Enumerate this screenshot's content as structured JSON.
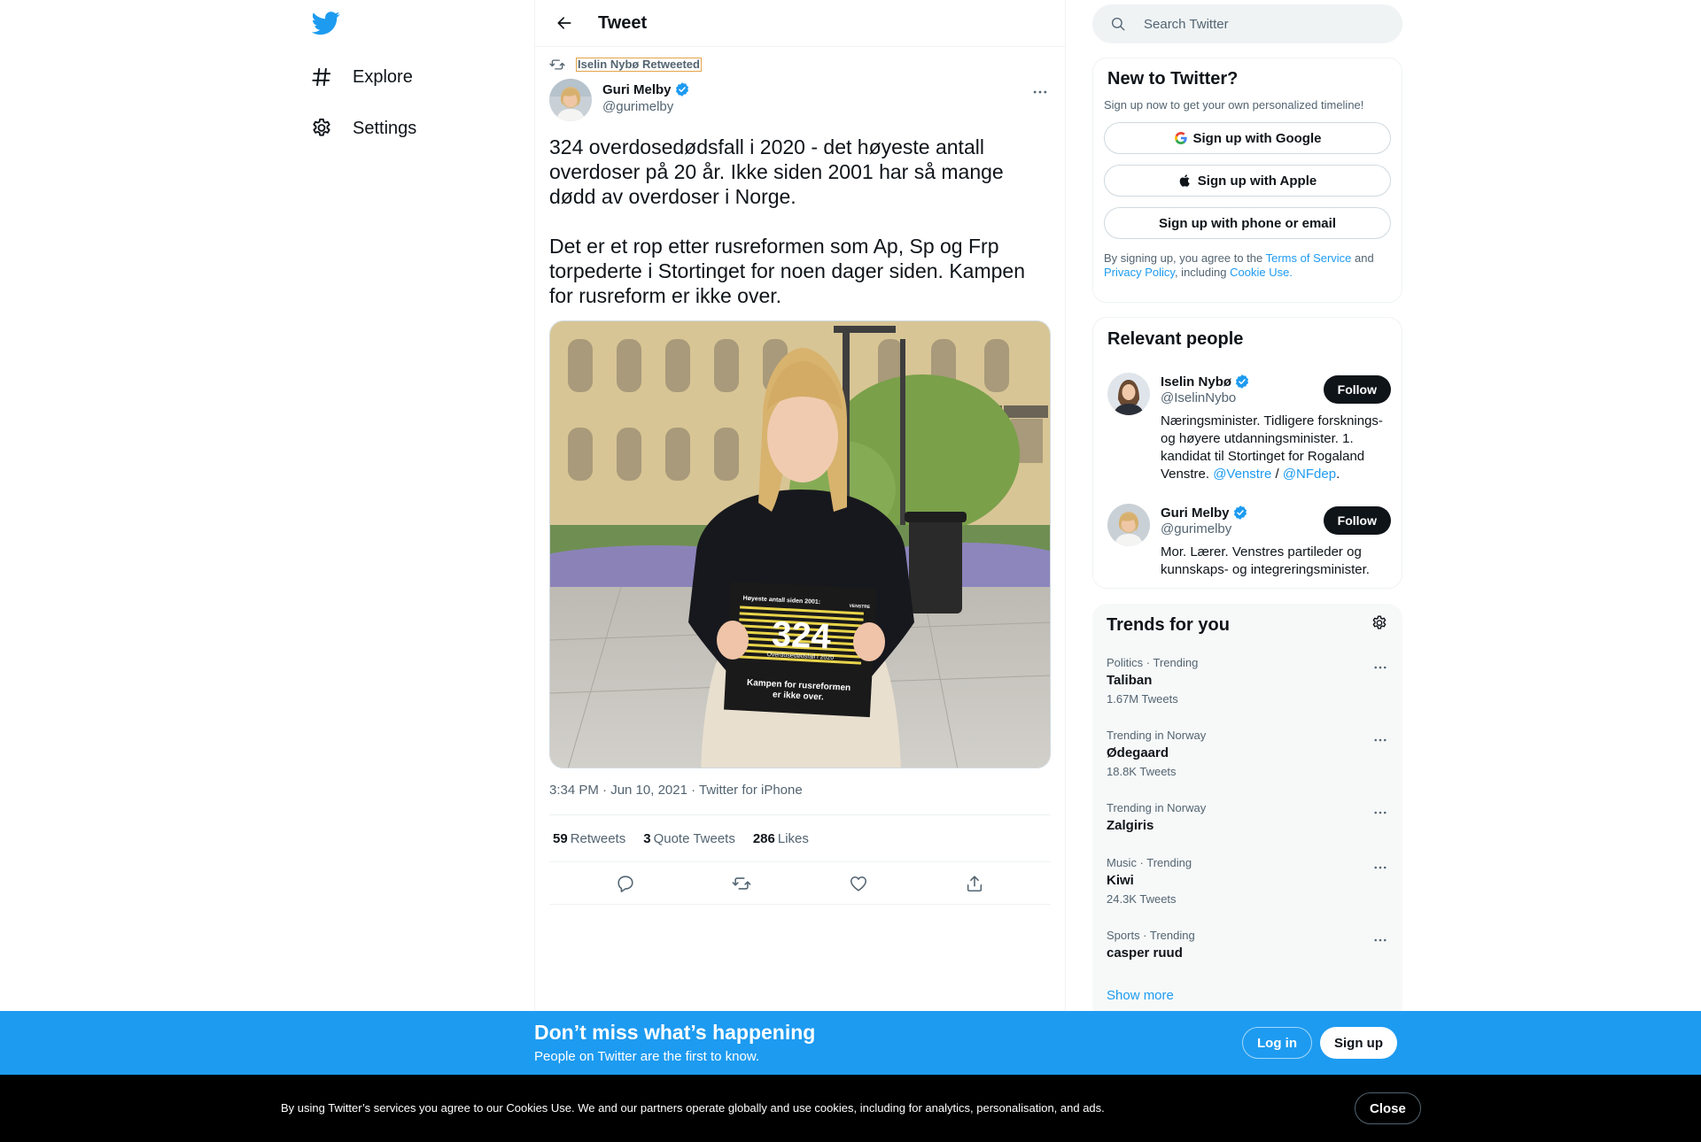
{
  "nav": {
    "explore": "Explore",
    "settings": "Settings"
  },
  "main": {
    "title": "Tweet",
    "retweeted_by": "Iselin Nybø Retweeted",
    "author_name": "Guri Melby",
    "author_handle": "@gurimelby",
    "text": "324 overdosedødsfall i 2020 - det høyeste antall overdoser på 20 år. Ikke siden 2001 har så mange dødd av overdoser i Norge.\n\nDet er et rop etter rusreformen som Ap, Sp og Frp torpederte i Stortinget for noen dager siden. Kampen for rusreform er ikke over.",
    "sign": {
      "header": "Høyeste antall siden 2001:",
      "number": "324",
      "caption": "Overdosedødsfall i 2020",
      "slogan_1": "Kampen for rusreformen",
      "slogan_2": "er ikke over.",
      "party": "VENSTRE"
    },
    "timestamp": "3:34 PM · Jun 10, 2021 · Twitter for iPhone",
    "retweets_count": "59",
    "retweets_label": "Retweets",
    "quotes_count": "3",
    "quotes_label": "Quote Tweets",
    "likes_count": "286",
    "likes_label": "Likes"
  },
  "search": {
    "placeholder": "Search Twitter"
  },
  "new_to_twitter": {
    "title": "New to Twitter?",
    "subtitle": "Sign up now to get your own personalized timeline!",
    "google": "Sign up with Google",
    "apple": "Sign up with Apple",
    "phone": "Sign up with phone or email",
    "legal_1": "By signing up, you agree to the ",
    "terms": "Terms of Service",
    "legal_2": " and ",
    "privacy": "Privacy Policy",
    "legal_3": ", including ",
    "cookie": "Cookie Use."
  },
  "relevant": {
    "title": "Relevant people",
    "people": [
      {
        "name": "Iselin Nybø",
        "handle": "@IselinNybo",
        "bio": "Næringsminister. Tidligere forsknings- og høyere utdanningsminister. 1. kandidat til Stortinget for Rogaland Venstre. ",
        "link1": "@Venstre",
        "sep": " / ",
        "link2": "@NFdep",
        "end": ".",
        "follow": "Follow"
      },
      {
        "name": "Guri Melby",
        "handle": "@gurimelby",
        "bio": "Mor. Lærer. Venstres partileder og kunnskaps- og integreringsminister.",
        "follow": "Follow"
      }
    ]
  },
  "trends": {
    "title": "Trends for you",
    "items": [
      {
        "category": "Politics · Trending",
        "name": "Taliban",
        "count": "1.67M Tweets"
      },
      {
        "category": "Trending in Norway",
        "name": "Ødegaard",
        "count": "18.8K Tweets"
      },
      {
        "category": "Trending in Norway",
        "name": "Zalgiris",
        "count": ""
      },
      {
        "category": "Music · Trending",
        "name": "Kiwi",
        "count": "24.3K Tweets"
      },
      {
        "category": "Sports · Trending",
        "name": "casper ruud",
        "count": ""
      }
    ],
    "show_more": "Show more"
  },
  "signup_bar": {
    "heading": "Don’t miss what’s happening",
    "sub": "People on Twitter are the first to know.",
    "login": "Log in",
    "signup": "Sign up"
  },
  "cookie_bar": {
    "text": "By using Twitter’s services you agree to our Cookies Use. We and our partners operate globally and use cookies, including for analytics, personalisation, and ads.",
    "close": "Close"
  },
  "colors": {
    "accent": "#1d9bf0",
    "text": "#0f1419",
    "secondary": "#536471",
    "cookie_bg": "#000000"
  }
}
